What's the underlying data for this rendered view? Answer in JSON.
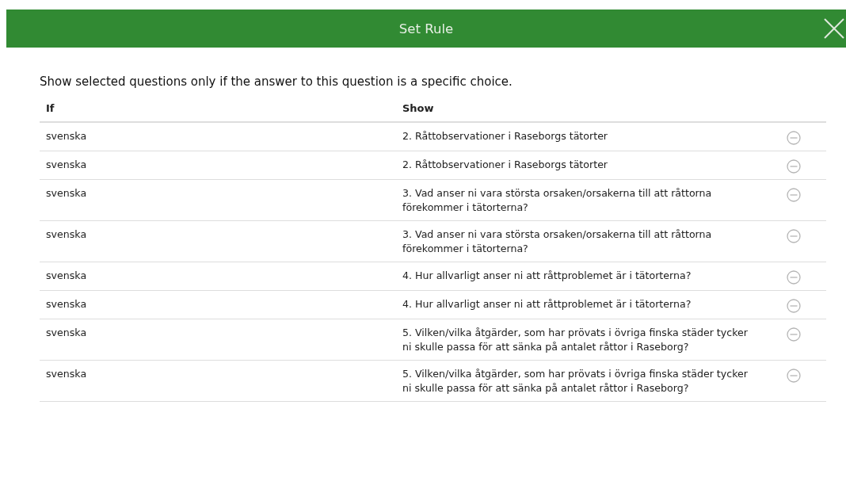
{
  "dialog": {
    "title": "Set Rule"
  },
  "instruction": "Show selected questions only if the answer to this question is a specific choice.",
  "table": {
    "columns": [
      "If",
      "Show"
    ],
    "rows": [
      {
        "if": "svenska",
        "show": "2. Råttobservationer i Raseborgs tätorter"
      },
      {
        "if": "svenska",
        "show": "2. Råttobservationer i Raseborgs tätorter"
      },
      {
        "if": "svenska",
        "show": "3. Vad anser ni vara största orsaken/orsakerna till att råttorna förekommer i tätorterna?"
      },
      {
        "if": "svenska",
        "show": "3. Vad anser ni vara största orsaken/orsakerna till att råttorna förekommer i tätorterna?"
      },
      {
        "if": "svenska",
        "show": "4. Hur allvarligt anser ni att råttproblemet är i tätorterna?"
      },
      {
        "if": "svenska",
        "show": "4. Hur allvarligt anser ni att råttproblemet är i tätorterna?"
      },
      {
        "if": "svenska",
        "show": "5. Vilken/vilka åtgärder, som har prövats i övriga finska städer tycker ni skulle passa för att sänka på antalet råttor i Raseborg?"
      },
      {
        "if": "svenska",
        "show": "5. Vilken/vilka åtgärder, som har prövats i övriga finska städer tycker ni skulle passa för att sänka på antalet råttor i Raseborg?"
      }
    ]
  }
}
